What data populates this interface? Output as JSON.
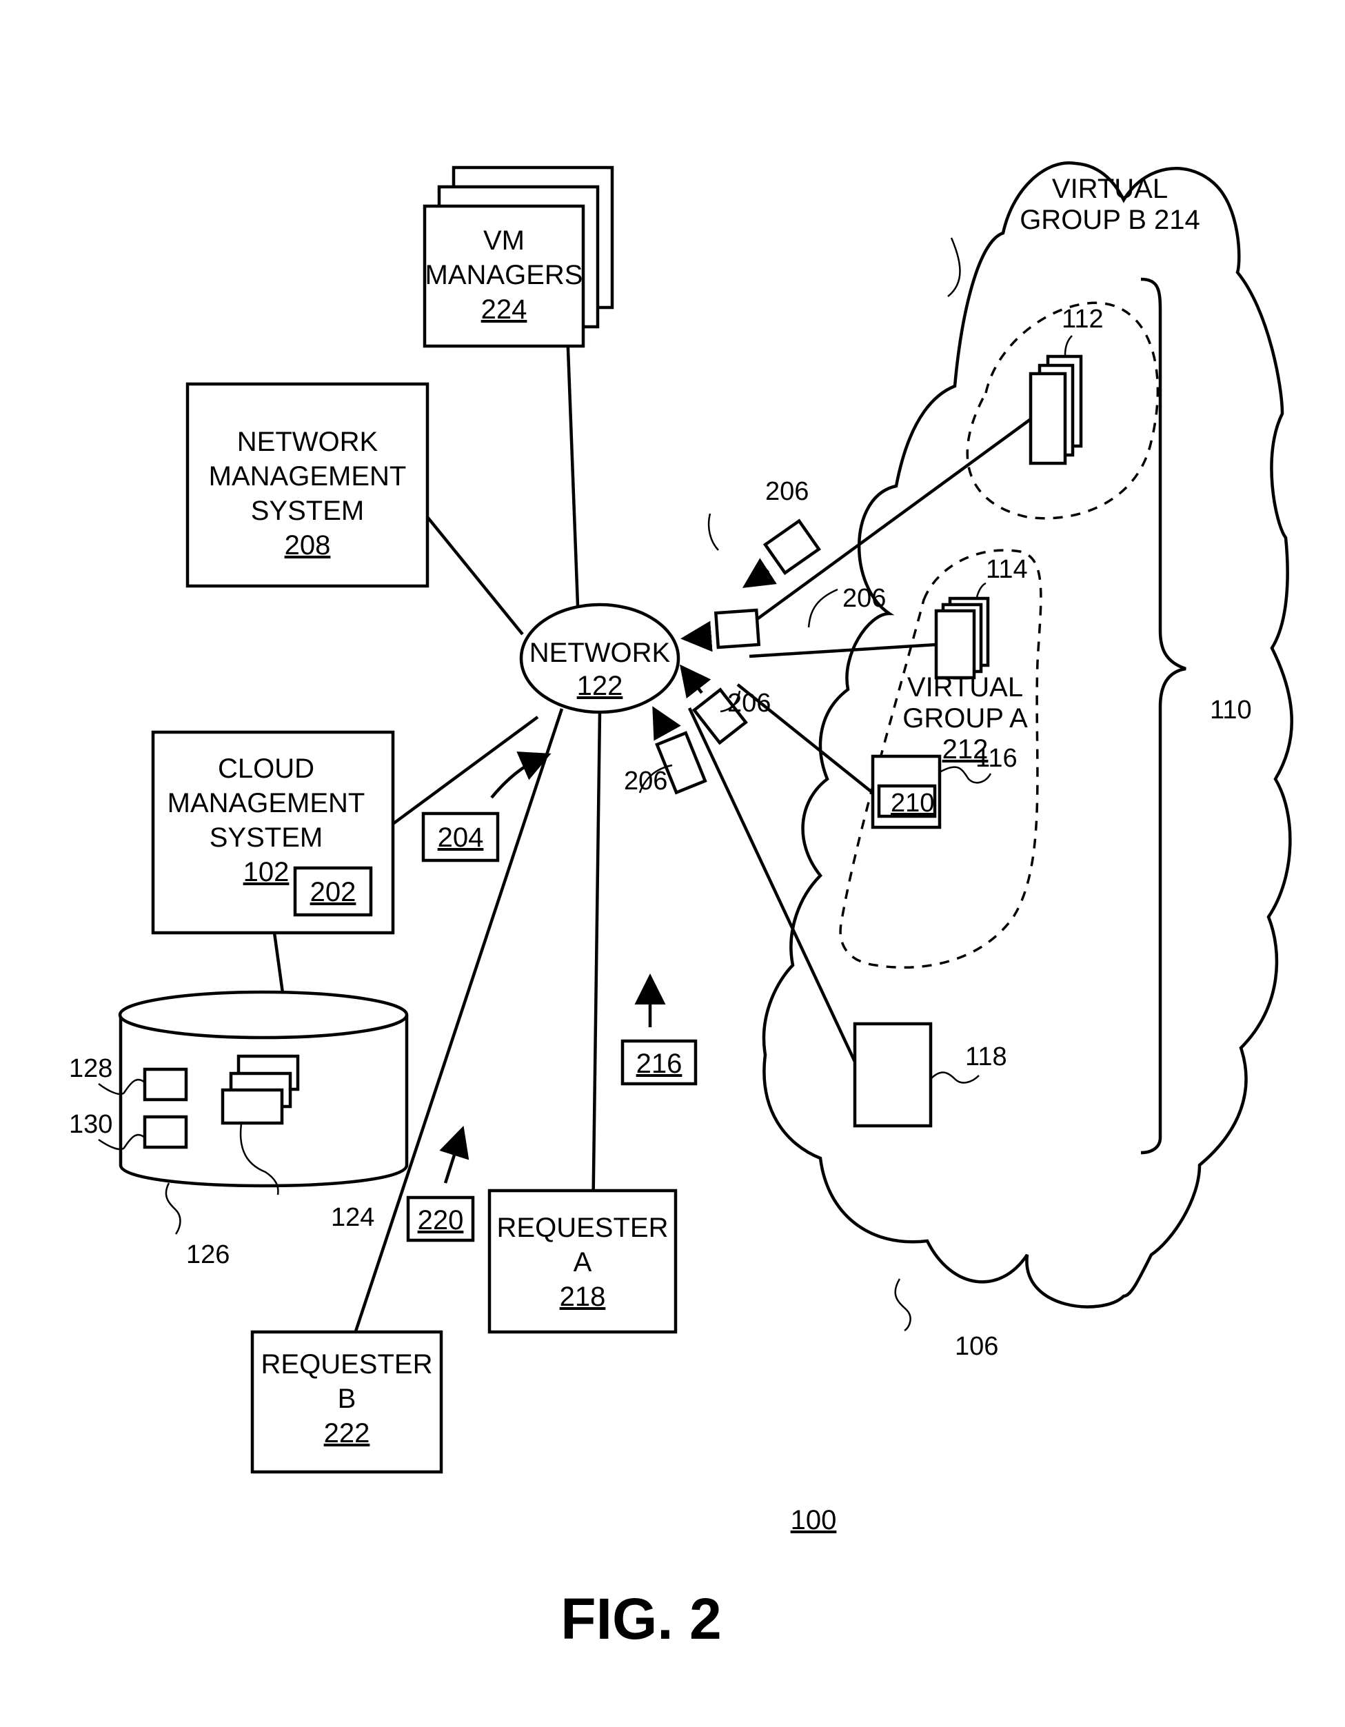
{
  "figure": {
    "title": "FIG. 2",
    "system_ref": "100"
  },
  "nodes": {
    "vm_managers": {
      "lines": [
        "VM",
        "MANAGERS"
      ],
      "ref": "224"
    },
    "network_management": {
      "lines": [
        "NETWORK",
        "MANAGEMENT",
        "SYSTEM"
      ],
      "ref": "208"
    },
    "cloud_management": {
      "lines": [
        "CLOUD",
        "MANAGEMENT",
        "SYSTEM"
      ],
      "ref": "102",
      "component_ref": "202"
    },
    "network": {
      "label": "NETWORK",
      "ref": "122"
    },
    "requester_a": {
      "lines": [
        "REQUESTER",
        "A"
      ],
      "ref": "218"
    },
    "requester_b": {
      "lines": [
        "REQUESTER",
        "B"
      ],
      "ref": "222"
    },
    "database": {
      "ref": "126",
      "item_refs": [
        "128",
        "130",
        "124"
      ]
    },
    "cloud": {
      "ref": "106",
      "bracket_ref": "110"
    },
    "virtual_group_b": {
      "lines": [
        "VIRTUAL",
        "GROUP B 214"
      ],
      "server_ref": "112"
    },
    "virtual_group_a": {
      "lines": [
        "VIRTUAL",
        "GROUP A"
      ],
      "ref": "212",
      "server_ref": "114"
    },
    "host_116": {
      "ref": "116",
      "inner_ref": "210"
    },
    "host_118": {
      "ref": "118"
    }
  },
  "messages": {
    "packet_ref": "206",
    "msg_204": "204",
    "msg_216": "216",
    "msg_220": "220"
  }
}
